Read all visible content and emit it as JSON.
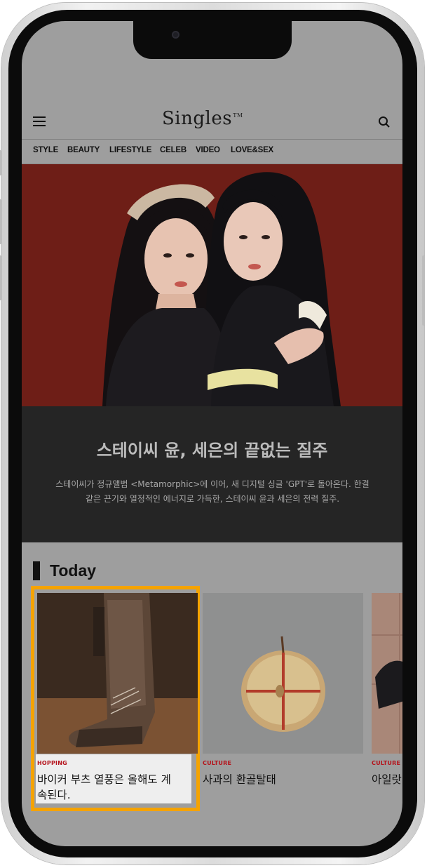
{
  "header": {
    "logo": "Singles",
    "logo_mark": "TM"
  },
  "nav": {
    "items": [
      "STYLE",
      "BEAUTY",
      "LIFESTYLE",
      "CELEB",
      "VIDEO",
      "LOVE&SEX"
    ]
  },
  "hero": {
    "title": "스테이씨 윤, 세은의 끝없는 질주",
    "description_line1": "스테이씨가 정규앨범 <Metamorphic>에 이어, 새 디지털 싱글 'GPT'로 돌아온다. 한결",
    "description_line2": "같은 끈기와 열정적인 에너지로 가득한, 스테이씨 윤과 세은의 전력 질주."
  },
  "today": {
    "heading": "Today",
    "cards": [
      {
        "category": "HOPPING",
        "title_line1": "바이커 부츠 열풍은 올해도 계",
        "title_line2": "속된다."
      },
      {
        "category": "CULTURE",
        "title_line1": "사과의 환골탈태",
        "title_line2": ""
      },
      {
        "category": "CULTURE",
        "title_line1": "아일랏",
        "title_line2": ""
      }
    ]
  },
  "colors": {
    "highlight": "#f5a300",
    "category": "#b5121b",
    "hero_bg": "#6f1f18",
    "hero_text_bg": "#252525"
  },
  "icons": {
    "menu": "menu-icon",
    "search": "search-icon"
  }
}
